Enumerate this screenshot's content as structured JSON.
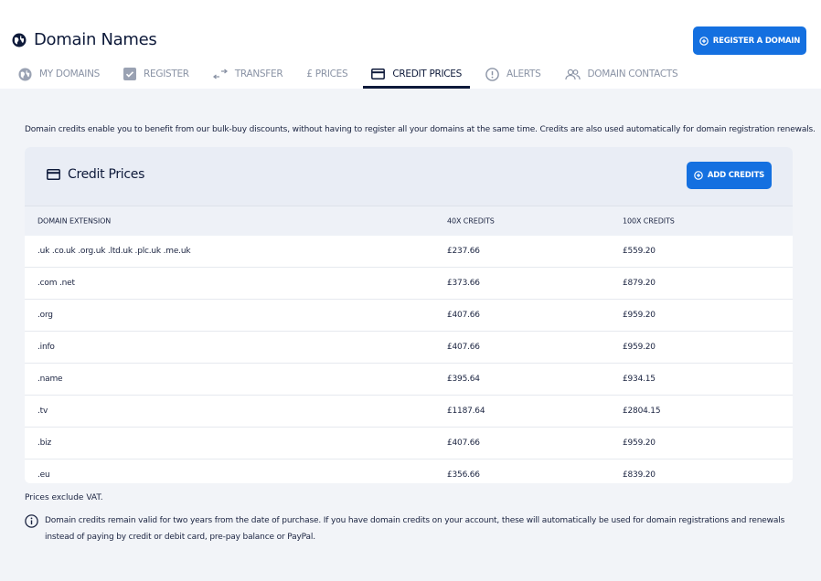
{
  "header": {
    "title": "Domain Names",
    "register_button": "REGISTER A DOMAIN"
  },
  "tabs": [
    {
      "label": "MY DOMAINS",
      "icon": "globe-icon"
    },
    {
      "label": "REGISTER",
      "icon": "checkbox-icon"
    },
    {
      "label": "TRANSFER",
      "icon": "transfer-arrows-icon"
    },
    {
      "label": "£ PRICES",
      "icon": ""
    },
    {
      "label": "CREDIT PRICES",
      "icon": "credit-card-icon",
      "active": true
    },
    {
      "label": "ALERTS",
      "icon": "alert-circle-icon"
    },
    {
      "label": "DOMAIN CONTACTS",
      "icon": "contacts-icon"
    }
  ],
  "intro": "Domain credits enable you to benefit from our bulk-buy discounts, without having to register all your domains at the same time. Credits are also used automatically for domain registration renewals.",
  "card": {
    "title": "Credit Prices",
    "add_button": "ADD CREDITS",
    "columns": [
      "DOMAIN EXTENSION",
      "40X CREDITS",
      "100X CREDITS"
    ],
    "rows": [
      [
        ".uk .co.uk .org.uk .ltd.uk .plc.uk .me.uk",
        "£237.66",
        "£559.20"
      ],
      [
        ".com .net",
        "£373.66",
        "£879.20"
      ],
      [
        ".org",
        "£407.66",
        "£959.20"
      ],
      [
        ".info",
        "£407.66",
        "£959.20"
      ],
      [
        ".name",
        "£395.64",
        "£934.15"
      ],
      [
        ".tv",
        "£1187.64",
        "£2804.15"
      ],
      [
        ".biz",
        "£407.66",
        "£959.20"
      ],
      [
        ".eu",
        "£356.66",
        "£839.20"
      ]
    ]
  },
  "vat_note": "Prices exclude VAT.",
  "info_note": "Domain credits remain valid for two years from the date of purchase. If you have domain credits on your account, these will automatically be used for domain registrations and renewals instead of paying by credit or debit card, pre-pay balance or PayPal.",
  "colors": {
    "accent": "#1470e0",
    "navy": "#0e1a3a",
    "muted": "#8a93a5",
    "page_bg": "#f2f4f8"
  }
}
